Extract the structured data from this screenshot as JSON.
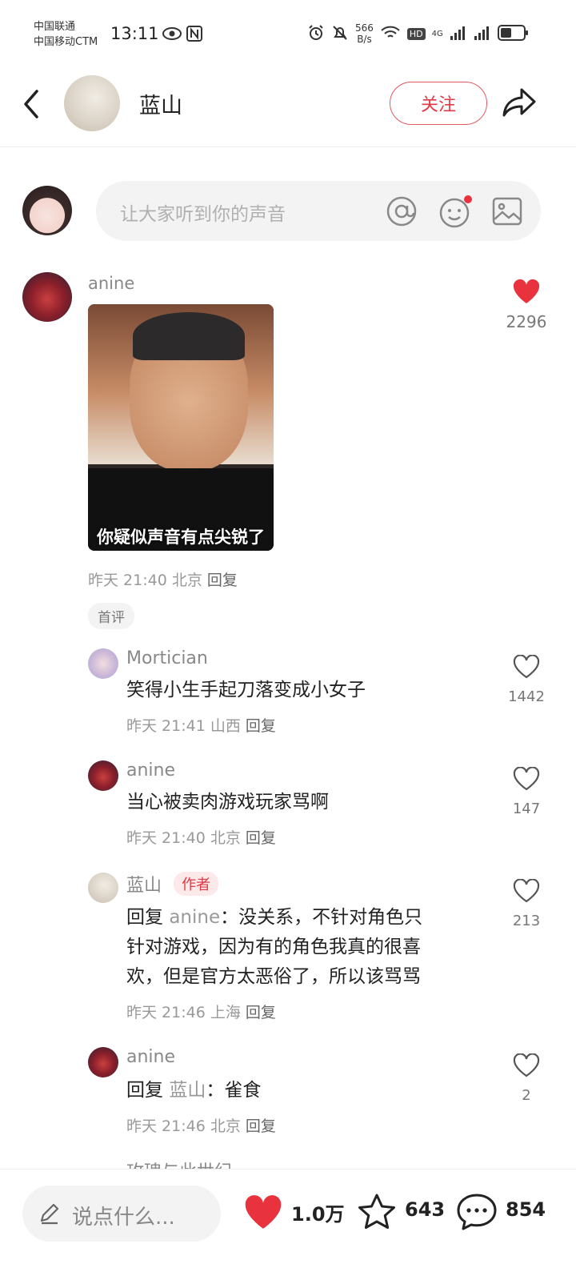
{
  "status_bar": {
    "carrier1": "中国联通",
    "carrier2": "中国移动CTM",
    "time": "13:11",
    "speed_value": "566",
    "speed_unit": "B/s",
    "hd_label": "HD",
    "network": "4G"
  },
  "header": {
    "username": "蓝山",
    "follow_label": "关注"
  },
  "composer": {
    "placeholder": "让大家听到你的声音"
  },
  "main_comment": {
    "username": "anine",
    "image_caption": "你疑似声音有点尖锐了",
    "time": "昨天 21:40",
    "location": "北京",
    "reply_label": "回复",
    "like_count": "2296",
    "liked": true,
    "tag": "首评"
  },
  "replies": [
    {
      "username": "Mortician",
      "text": "笑得小生手起刀落变成小女子",
      "time": "昨天 21:41",
      "location": "山西",
      "reply_label": "回复",
      "like_count": "1442"
    },
    {
      "username": "anine",
      "text": "当心被卖肉游戏玩家骂啊",
      "time": "昨天 21:40",
      "location": "北京",
      "reply_label": "回复",
      "like_count": "147"
    },
    {
      "username": "蓝山",
      "author_tag": "作者",
      "reply_prefix": "回复",
      "reply_to": "anine",
      "line1": "：没关系，不针对角色只",
      "line2": "针对游戏，因为有的角色我真的很喜",
      "line3": "欢，但是官方太恶俗了，所以该骂骂",
      "time": "昨天 21:46",
      "location": "上海",
      "reply_label": "回复",
      "like_count": "213"
    },
    {
      "username": "anine",
      "reply_prefix": "回复",
      "reply_to": "蓝山",
      "text": "：雀食",
      "time": "昨天 21:46",
      "location": "北京",
      "reply_label": "回复",
      "like_count": "2"
    }
  ],
  "partial_next": {
    "username": "玫瑰与此世纪"
  },
  "bottom_bar": {
    "input_placeholder": "说点什么...",
    "likes": "1.0万",
    "favorites": "643",
    "comments": "854"
  },
  "colors": {
    "accent_red": "#e8333f",
    "muted_text": "#999999",
    "input_bg": "#f3f3f3"
  }
}
